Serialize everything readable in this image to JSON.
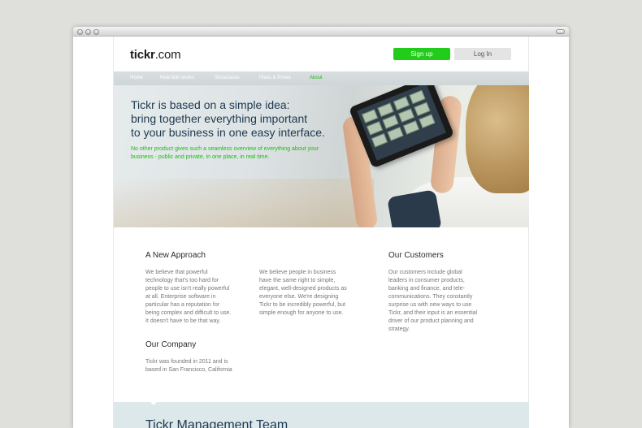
{
  "site": {
    "logo_bold": "tickr",
    "logo_rest": ".com",
    "signup_label": "Sign up",
    "login_label": "Log In"
  },
  "nav": {
    "items": [
      {
        "label": "Home"
      },
      {
        "label": "How tickr works"
      },
      {
        "label": "Showcases"
      },
      {
        "label": "Plans & Prices"
      },
      {
        "label": "About",
        "active": true
      }
    ]
  },
  "hero": {
    "title_line1": "Tickr is based on a simple idea:",
    "title_line2": "bring together everything important",
    "title_line3": "to your business in one easy interface.",
    "subtitle_line1": "No other product gives such a seamless overview of everything about your",
    "subtitle_line2": "business - public and private, in one place, in real time."
  },
  "sections": {
    "approach": {
      "heading": "A New Approach",
      "lines": [
        "We believe that powerful",
        "technology that's too hard for",
        "people to use isn't really powerful",
        "at all. Enterprise software in",
        "particular has a reputation for",
        "being complex and difficult to use.",
        "It doesn't have to be that way."
      ]
    },
    "middle": {
      "lines": [
        "We believe people in business",
        "have the same right to simple,",
        "elegant, well-designed products as",
        "everyone else. We're designing",
        "Tickr to be incredibly powerful, but",
        "simple enough for anyone to use."
      ]
    },
    "customers": {
      "heading": "Our Customers",
      "lines": [
        "Our customers include global",
        "leaders in consumer products,",
        "banking and finance, and tele-",
        "communications. They constantly",
        "surprise us with new ways to use",
        "Tickr, and their input is an essential",
        "driver of our product planning and",
        "strategy."
      ]
    },
    "company": {
      "heading": "Our Company",
      "lines": [
        "Tickr was founded in 2011 and is",
        "based in San Francisco, California"
      ]
    }
  },
  "team": {
    "heading": "Tickr Management Team"
  },
  "colors": {
    "accent_green": "#22cc1a",
    "heading_navy": "#1d3850",
    "body_gray": "#777777"
  }
}
